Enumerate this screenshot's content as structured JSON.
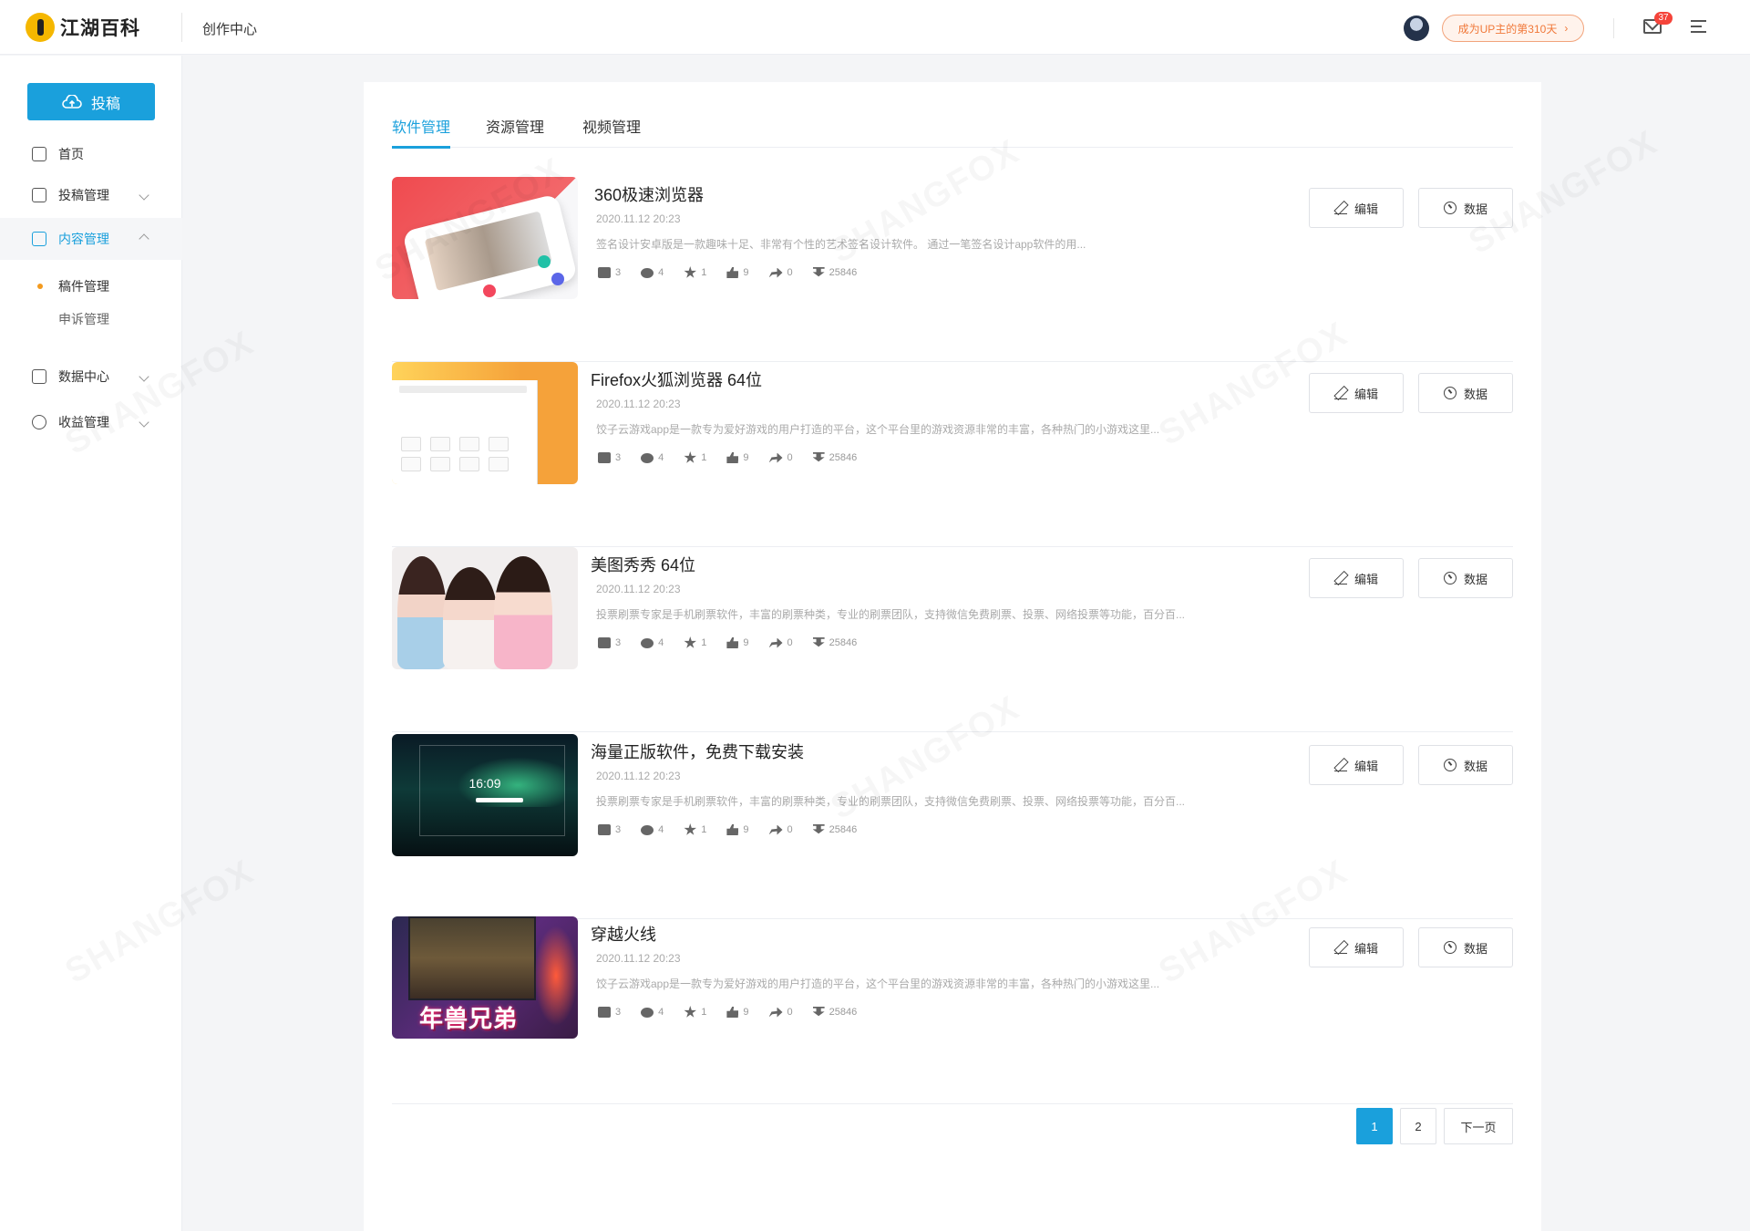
{
  "header": {
    "logo_text": "江湖百科",
    "section_title": "创作中心",
    "up_badge": "成为UP主的第310天",
    "mail_count": "37"
  },
  "sidebar": {
    "post_button": "投稿",
    "items": [
      {
        "label": "首页",
        "icon": "home-icon"
      },
      {
        "label": "投稿管理",
        "icon": "edit-doc-icon"
      },
      {
        "label": "内容管理",
        "icon": "content-icon"
      },
      {
        "label": "数据中心",
        "icon": "chart-icon"
      },
      {
        "label": "收益管理",
        "icon": "money-bag-icon"
      }
    ],
    "sub_items": [
      {
        "label": "稿件管理"
      },
      {
        "label": "申诉管理"
      }
    ]
  },
  "tabs": [
    {
      "label": "软件管理"
    },
    {
      "label": "资源管理"
    },
    {
      "label": "视频管理"
    }
  ],
  "actions": {
    "edit": "编辑",
    "data": "数据"
  },
  "items": [
    {
      "title": "360极速浏览器",
      "date": "2020.11.12 20:23",
      "desc": "签名设计安卓版是一款趣味十足、非常有个性的艺术签名设计软件。 通过一笔签名设计app软件的用...",
      "stats": {
        "posts": "3",
        "comments": "4",
        "stars": "1",
        "likes": "9",
        "shares": "0",
        "downloads": "25846"
      }
    },
    {
      "title": "Firefox火狐浏览器 64位",
      "date": "2020.11.12 20:23",
      "desc": "饺子云游戏app是一款专为爱好游戏的用户打造的平台，这个平台里的游戏资源非常的丰富，各种热门的小游戏这里...",
      "stats": {
        "posts": "3",
        "comments": "4",
        "stars": "1",
        "likes": "9",
        "shares": "0",
        "downloads": "25846"
      }
    },
    {
      "title": "美图秀秀 64位",
      "date": "2020.11.12 20:23",
      "desc": "投票刷票专家是手机刷票软件，丰富的刷票种类，专业的刷票团队，支持微信免费刷票、投票、网络投票等功能，百分百...",
      "stats": {
        "posts": "3",
        "comments": "4",
        "stars": "1",
        "likes": "9",
        "shares": "0",
        "downloads": "25846"
      }
    },
    {
      "title": "海量正版软件，免费下载安装",
      "date": "2020.11.12 20:23",
      "desc": "投票刷票专家是手机刷票软件，丰富的刷票种类，专业的刷票团队，支持微信免费刷票、投票、网络投票等功能，百分百...",
      "stats": {
        "posts": "3",
        "comments": "4",
        "stars": "1",
        "likes": "9",
        "shares": "0",
        "downloads": "25846"
      },
      "thumb_clock": "16:09"
    },
    {
      "title": "穿越火线",
      "date": "2020.11.12 20:23",
      "desc": "饺子云游戏app是一款专为爱好游戏的用户打造的平台，这个平台里的游戏资源非常的丰富，各种热门的小游戏这里...",
      "stats": {
        "posts": "3",
        "comments": "4",
        "stars": "1",
        "likes": "9",
        "shares": "0",
        "downloads": "25846"
      },
      "thumb_title": "年兽兄弟"
    }
  ],
  "pagination": {
    "pages": [
      "1",
      "2"
    ],
    "next": "下一页",
    "current": "1"
  },
  "watermark": "SHANGFOX"
}
